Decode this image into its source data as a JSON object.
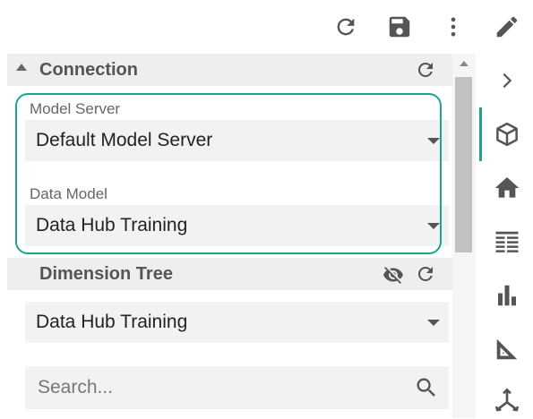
{
  "toolbar": {
    "icons": [
      "refresh-icon",
      "save-icon",
      "more-vert-icon",
      "edit-icon"
    ]
  },
  "connection": {
    "title": "Connection",
    "model_server": {
      "label": "Model Server",
      "value": "Default Model Server"
    },
    "data_model": {
      "label": "Data Model",
      "value": "Data Hub Training"
    }
  },
  "dimension_tree": {
    "title": "Dimension Tree",
    "select_value": "Data Hub Training",
    "search_placeholder": "Search..."
  },
  "rail": {
    "icons": [
      "chevron-right-icon",
      "cube-icon",
      "home-icon",
      "list-icon",
      "bar-chart-icon",
      "triangle-ruler-icon",
      "axes-icon"
    ],
    "active": "cube-icon"
  },
  "colors": {
    "accent": "#1fa38f",
    "header_bg": "#eeeeee",
    "field_bg": "#f2f2f2",
    "icon": "#555555"
  }
}
